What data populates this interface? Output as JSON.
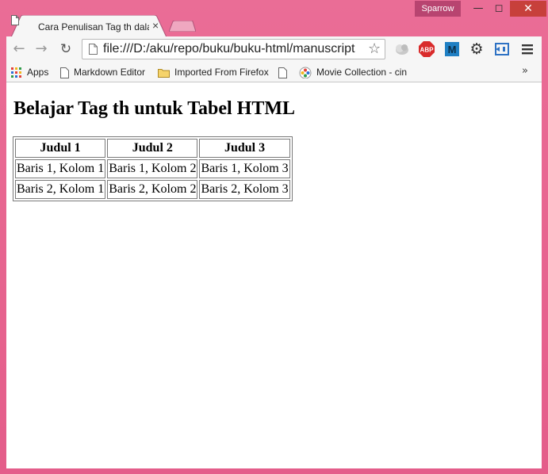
{
  "window": {
    "user_badge": "Sparrow",
    "minimize_glyph": "—",
    "maximize_glyph": "◻",
    "close_glyph": "✕"
  },
  "tab": {
    "title": "Cara Penulisan Tag th dala",
    "close_glyph": "×"
  },
  "toolbar": {
    "back_glyph": "←",
    "forward_glyph": "→",
    "reload_glyph": "↻",
    "url": "file:///D:/aku/repo/buku/buku-html/manuscript",
    "star_glyph": "☆",
    "gear_glyph": "⚙",
    "abp_label": "ABP",
    "m_label": "M"
  },
  "bookmarks": {
    "items": [
      {
        "label": "Apps",
        "icon": "apps-grid-icon"
      },
      {
        "label": "Markdown Editor",
        "icon": "page-icon"
      },
      {
        "label": "Imported From Firefox",
        "icon": "folder-icon"
      },
      {
        "label": "",
        "icon": "page-icon"
      },
      {
        "label": "Movie Collection - cin",
        "icon": "movie-icon"
      }
    ],
    "more_glyph": "»"
  },
  "page": {
    "heading": "Belajar Tag th untuk Tabel HTML",
    "table": {
      "headers": [
        "Judul 1",
        "Judul 2",
        "Judul 3"
      ],
      "rows": [
        [
          "Baris 1, Kolom 1",
          "Baris 1, Kolom 2",
          "Baris 1, Kolom 3"
        ],
        [
          "Baris 2, Kolom 1",
          "Baris 2, Kolom 2",
          "Baris 2, Kolom 3"
        ]
      ]
    }
  },
  "colors": {
    "window_frame": "#e8628e",
    "toolbar_bg": "#f6f6f6",
    "close_button": "#c7403b",
    "abp_red": "#d92b2b",
    "m_blue": "#1f7fc3"
  }
}
